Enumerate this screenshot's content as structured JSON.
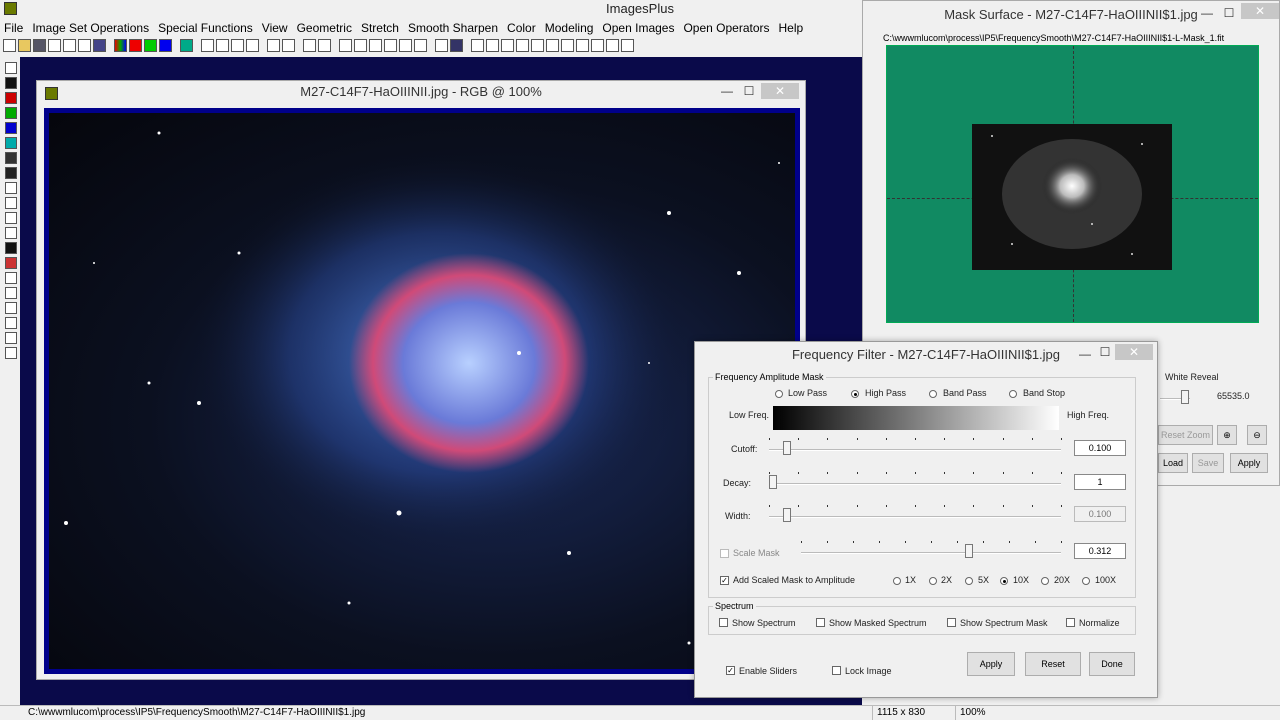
{
  "app": {
    "title": "ImagesPlus"
  },
  "menubar": [
    {
      "label": "File"
    },
    {
      "label": "Image Set Operations"
    },
    {
      "label": "Special Functions"
    },
    {
      "label": "View"
    },
    {
      "label": "Geometric"
    },
    {
      "label": "Stretch"
    },
    {
      "label": "Smooth Sharpen"
    },
    {
      "label": "Color"
    },
    {
      "label": "Modeling"
    },
    {
      "label": "Open Images"
    },
    {
      "label": "Open Operators"
    },
    {
      "label": "Help"
    }
  ],
  "image_window": {
    "title": "M27-C14F7-HaOIIINII.jpg - RGB @ 100%",
    "minimize": "—",
    "maximize": "☐",
    "close": "✕"
  },
  "mask_window": {
    "title": "Mask Surface - M27-C14F7-HaOIIINII$1.jpg",
    "path": "C:\\wwwmlucom\\process\\IP5\\FrequencySmooth\\M27-C14F7-HaOIIINII$1-L-Mask_1.fit",
    "minimize": "—",
    "maximize": "☐",
    "close": "✕",
    "white_reveal_label": "White Reveal",
    "white_reveal_value": "65535.0",
    "reset_zoom": "Reset Zoom",
    "load": "Load",
    "save": "Save",
    "apply": "Apply"
  },
  "freq_window": {
    "title": "Frequency Filter - M27-C14F7-HaOIIINII$1.jpg",
    "minimize": "—",
    "maximize": "☐",
    "close": "✕",
    "amp_group": "Frequency Amplitude Mask",
    "modes": [
      {
        "label": "Low Pass",
        "selected": false
      },
      {
        "label": "High Pass",
        "selected": true
      },
      {
        "label": "Band Pass",
        "selected": false
      },
      {
        "label": "Band Stop",
        "selected": false
      }
    ],
    "low_freq": "Low Freq.",
    "high_freq": "High Freq.",
    "cutoff_label": "Cutoff:",
    "cutoff_value": "0.100",
    "cutoff_level": 0.05,
    "decay_label": "Decay:",
    "decay_value": "1",
    "decay_level": 0.0,
    "width_label": "Width:",
    "width_value": "0.100",
    "width_level": 0.05,
    "scale_mask_label": "Scale Mask",
    "scale_value": "0.312",
    "scale_level": 0.65,
    "add_scaled_label": "Add Scaled Mask to Amplitude",
    "add_scaled_checked": true,
    "multipliers": [
      {
        "label": "1X",
        "selected": false
      },
      {
        "label": "2X",
        "selected": false
      },
      {
        "label": "5X",
        "selected": false
      },
      {
        "label": "10X",
        "selected": true
      },
      {
        "label": "20X",
        "selected": false
      },
      {
        "label": "100X",
        "selected": false
      }
    ],
    "spectrum_group": "Spectrum",
    "spectrum_opts": [
      {
        "label": "Show Spectrum",
        "checked": false
      },
      {
        "label": "Show Masked Spectrum",
        "checked": false
      },
      {
        "label": "Show Spectrum Mask",
        "checked": false
      },
      {
        "label": "Normalize",
        "checked": false
      }
    ],
    "enable_sliders": "Enable Sliders",
    "enable_sliders_checked": true,
    "lock_image": "Lock Image",
    "lock_image_checked": false,
    "apply": "Apply",
    "reset": "Reset",
    "done": "Done"
  },
  "statusbar": {
    "path": "C:\\wwwmlucom\\process\\IP5\\FrequencySmooth\\M27-C14F7-HaOIIINII$1.jpg",
    "size": "1115 x 830",
    "zoom": "100%"
  },
  "colors": {
    "workspace": "#0a0a4a",
    "mask_plot": "#118a62",
    "image_frame": "#00008a",
    "close_button": "#c7c7c7"
  }
}
